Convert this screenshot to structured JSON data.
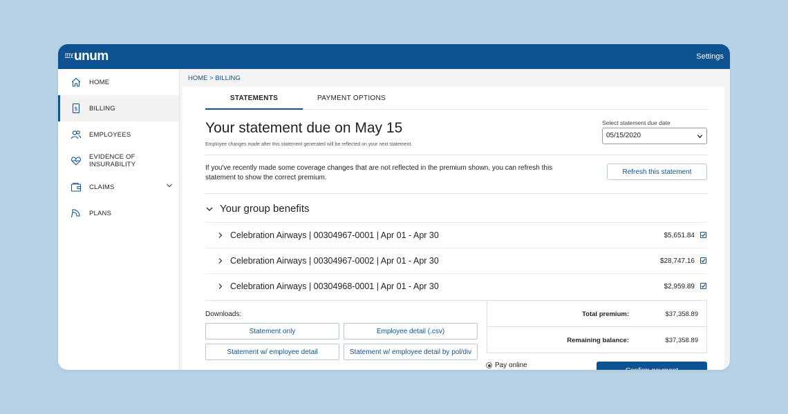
{
  "header": {
    "logo_prefix": "my",
    "logo_brand": "unum",
    "settings_label": "Settings"
  },
  "sidebar": {
    "items": [
      {
        "label": "HOME",
        "icon": "home-icon"
      },
      {
        "label": "BILLING",
        "icon": "billing-icon"
      },
      {
        "label": "EMPLOYEES",
        "icon": "employees-icon"
      },
      {
        "label": "EVIDENCE OF INSURABILITY",
        "icon": "heart-icon"
      },
      {
        "label": "CLAIMS",
        "icon": "claims-icon"
      },
      {
        "label": "PLANS",
        "icon": "plans-icon"
      }
    ],
    "active_index": 1
  },
  "breadcrumb": "HOME > BILLING",
  "tabs": [
    {
      "label": "STATEMENTS"
    },
    {
      "label": "PAYMENT OPTIONS"
    }
  ],
  "statement": {
    "title": "Your statement due on May 15",
    "subtitle": "Employee changes made after this statement generated will be reflected on your next statement.",
    "date_label": "Select statement due date",
    "date_value": "05/15/2020",
    "refresh_text": "If you've recently made some coverage changes that are not reflected in the premium shown, you can refresh this statement to show the correct premium.",
    "refresh_button": "Refresh this statement"
  },
  "group_benefits": {
    "title": "Your group benefits",
    "rows": [
      {
        "name": "Celebration Airways | 00304967-0001 | Apr 01 - Apr 30",
        "amount": "$5,651.84",
        "checked": true
      },
      {
        "name": "Celebration Airways | 00304967-0002 | Apr 01 - Apr 30",
        "amount": "$28,747.16",
        "checked": true
      },
      {
        "name": "Celebration Airways | 00304968-0001 | Apr 01 - Apr 30",
        "amount": "$2,959.89",
        "checked": true
      }
    ]
  },
  "downloads": {
    "label": "Downloads:",
    "buttons": [
      "Statement only",
      "Employee detail (.csv)",
      "Statement w/ employee detail",
      "Statement w/ employee detail by pol/div"
    ]
  },
  "totals": {
    "total_label": "Total premium:",
    "total_value": "$37,358.89",
    "remaining_label": "Remaining balance:",
    "remaining_value": "$37,358.89"
  },
  "payment": {
    "pay_online_label": "Pay online",
    "confirm_button": "Confirm payment"
  },
  "colors": {
    "brand_blue": "#0f5291",
    "background": "#b8d3e8"
  }
}
